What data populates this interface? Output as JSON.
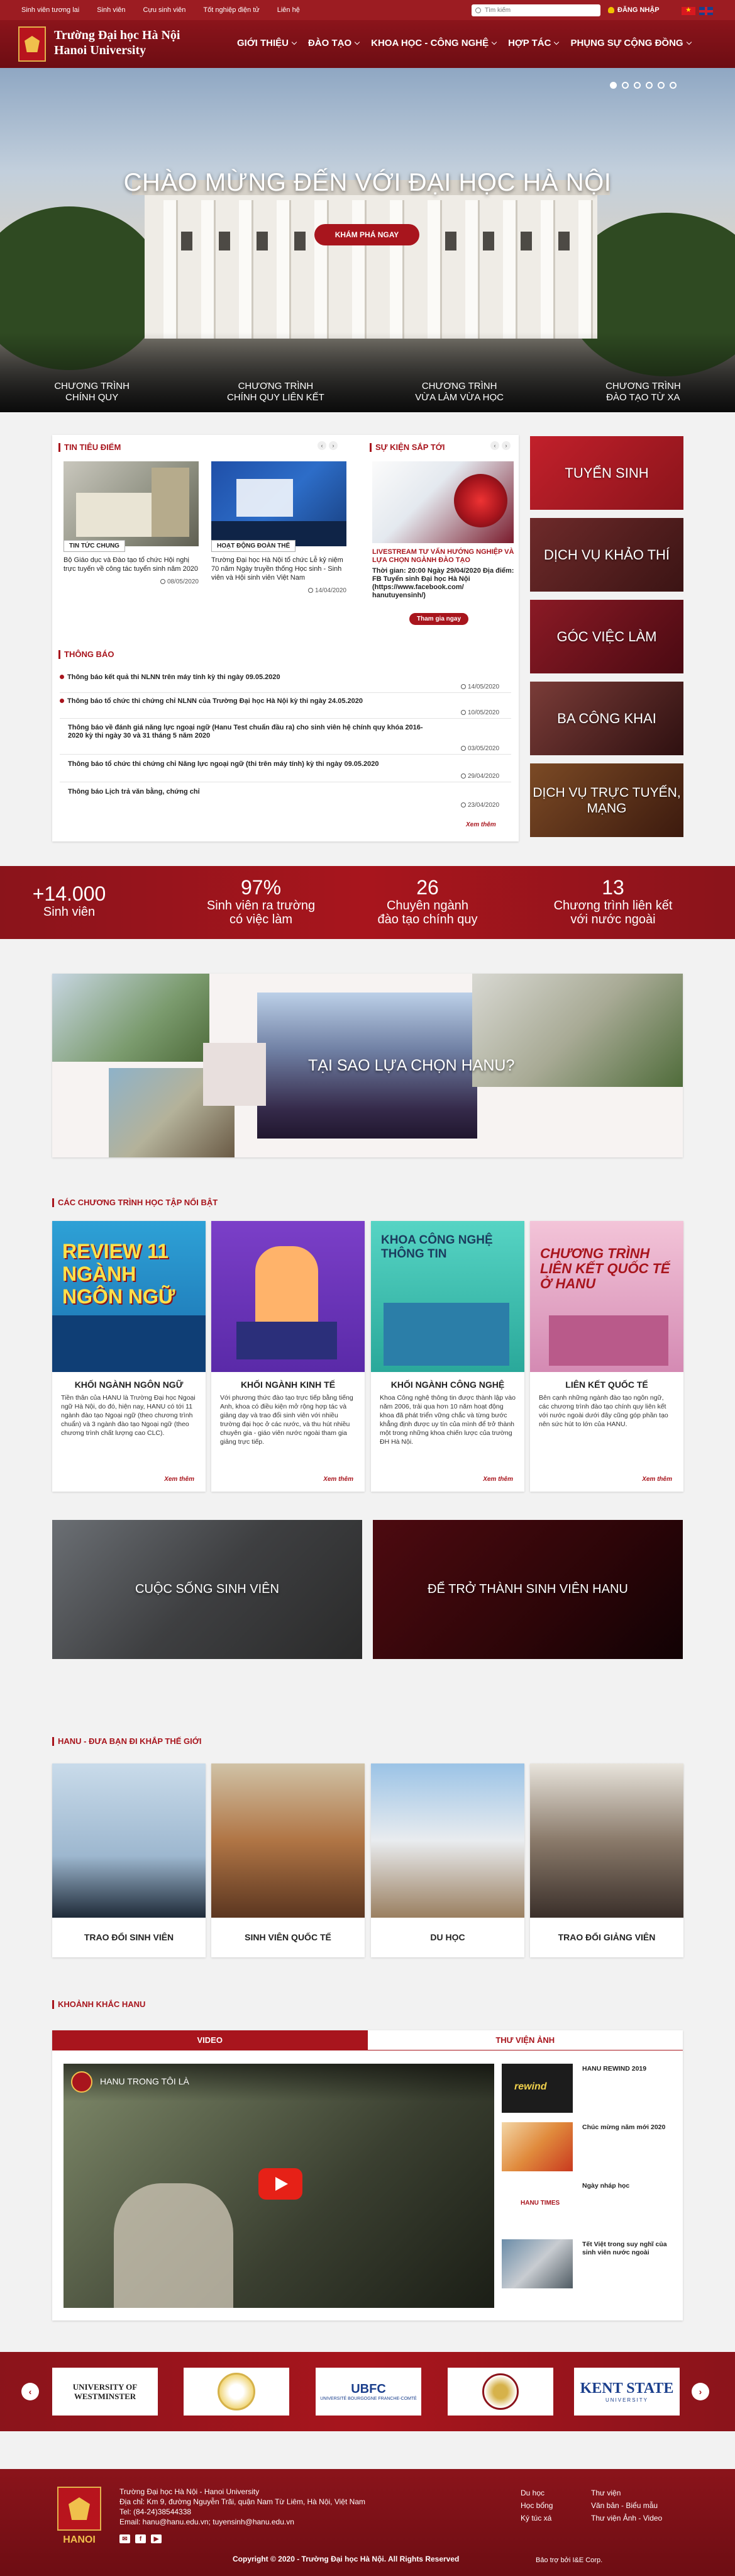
{
  "topbar": {
    "links": [
      "Sinh viên tương lai",
      "Sinh viên",
      "Cựu sinh viên",
      "Tốt nghiệp điện tử",
      "Liên hệ"
    ],
    "search_placeholder": "Tìm kiếm",
    "login": "ĐĂNG NHẬP"
  },
  "header": {
    "name_vn": "Trường Đại học Hà Nội",
    "name_en": "Hanoi University",
    "logo_caption": "HANOI",
    "nav": [
      "GIỚI THIỆU",
      "ĐÀO TẠO",
      "KHOA HỌC - CÔNG NGHỆ",
      "HỢP TÁC",
      "PHỤNG SỰ CỘNG ĐỒNG"
    ]
  },
  "hero": {
    "title": "CHÀO MỪNG ĐẾN VỚI ĐẠI HỌC HÀ NỘI",
    "button": "KHÁM PHÁ NGAY",
    "programs": [
      {
        "l1": "CHƯƠNG TRÌNH",
        "l2": "CHÍNH QUY"
      },
      {
        "l1": "CHƯƠNG TRÌNH",
        "l2": "CHÍNH QUY LIÊN KẾT"
      },
      {
        "l1": "CHƯƠNG TRÌNH",
        "l2": "VỪA LÀM VỪA HỌC"
      },
      {
        "l1": "CHƯƠNG TRÌNH",
        "l2": "ĐÀO TẠO TỪ XA"
      }
    ]
  },
  "news": {
    "heading": "TIN TIÊU ĐIỂM",
    "items": [
      {
        "tag": "TIN TỨC CHUNG",
        "title": "Bộ Giáo dục và Đào tạo tổ chức Hội nghị trực tuyến về công tác tuyển sinh năm 2020",
        "date": "08/05/2020"
      },
      {
        "tag": "HOẠT ĐỘNG ĐOÀN THỂ",
        "title": "Trường Đại học Hà Nội tổ chức Lễ kỷ niệm 70 năm Ngày truyền thống Học sinh - Sinh viên và Hội sinh viên Việt Nam",
        "date": "14/04/2020"
      }
    ]
  },
  "events": {
    "heading": "SỰ KIỆN SẮP TỚI",
    "title": "LIVESTREAM TƯ VẤN HƯỚNG NGHIỆP VÀ LỰA CHỌN NGÀNH ĐÀO TẠO",
    "info": "Thời gian: 20:00 Ngày 29/04/2020 Địa điểm: FB Tuyển sinh Đại học Hà Nội (https://www.facebook.com/ hanutuyensinh/)",
    "button": "Tham gia ngay"
  },
  "announcements": {
    "heading": "THÔNG BÁO",
    "items": [
      {
        "text": "Thông báo kết quả thi NLNN trên máy tính kỳ thi ngày 09.05.2020",
        "date": "14/05/2020",
        "hot": true
      },
      {
        "text": "Thông báo tổ chức thi chứng chỉ NLNN của Trường Đại học Hà Nội kỳ thi ngày 24.05.2020",
        "date": "10/05/2020",
        "hot": true
      },
      {
        "text": "Thông báo về đánh giá năng lực ngoại ngữ (Hanu Test chuẩn đầu ra) cho sinh viên hệ chính quy khóa 2016-2020 kỳ thi ngày 30 và 31 tháng 5 năm 2020",
        "date": "03/05/2020",
        "hot": false
      },
      {
        "text": "Thông báo tổ chức thi chứng chỉ Năng lực ngoại ngữ (thi trên máy tính) kỳ thi ngày 09.05.2020",
        "date": "29/04/2020",
        "hot": false
      },
      {
        "text": "Thông báo Lịch trả văn bằng, chứng chỉ",
        "date": "23/04/2020",
        "hot": false
      }
    ],
    "more": "Xem thêm"
  },
  "side_tiles": [
    "TUYỂN SINH",
    "DỊCH VỤ KHẢO THÍ",
    "GÓC VIỆC LÀM",
    "BA CÔNG KHAI",
    "DỊCH VỤ TRỰC TUYẾN, MẠNG"
  ],
  "stats": [
    {
      "num": "+14.000",
      "l1": "Sinh viên",
      "l2": ""
    },
    {
      "num": "97%",
      "l1": "Sinh viên ra trường",
      "l2": "có việc làm"
    },
    {
      "num": "26",
      "l1": "Chuyên ngành",
      "l2": "đào tạo chính quy"
    },
    {
      "num": "13",
      "l1": "Chương trình liên kết",
      "l2": "với nước ngoài"
    }
  ],
  "why": {
    "label": "TẠI SAO LỰA CHỌN HANU?"
  },
  "programs": {
    "heading": "CÁC CHƯƠNG TRÌNH HỌC TẬP NỔI BẬT",
    "cards": [
      {
        "img_text": "REVIEW 11 NGÀNH NGÔN NGỮ",
        "title": "KHỐI NGÀNH NGÔN NGỮ",
        "desc": "Tiền thân của HANU là Trường Đại học Ngoại ngữ Hà Nội, do đó, hiện nay, HANU có tới 11 ngành đào tạo Ngoại ngữ (theo chương trình chuẩn) và 3 ngành đào tạo Ngoại ngữ (theo chương trình chất lượng cao CLC).",
        "more": "Xem thêm"
      },
      {
        "img_text": "",
        "title": "KHỐI NGÀNH KINH TẾ",
        "desc": "Với phương thức đào tạo trực tiếp bằng tiếng Anh, khoa có điều kiện mở rộng hợp tác và giảng dạy và trao đổi sinh viên với nhiều trường đại học ở các nước, và thu hút nhiều chuyên gia - giáo viên nước ngoài tham gia giảng trực tiếp.",
        "more": "Xem thêm"
      },
      {
        "img_text": "KHOA CÔNG NGHỆ THÔNG TIN",
        "title": "KHỐI NGÀNH CÔNG NGHỆ",
        "desc": "Khoa Công nghệ thông tin được thành lập vào năm 2006, trải qua hơn 10 năm hoạt động khoa đã phát triển vững chắc và từng bước khẳng định được uy tín của mình để trở thành một trong những khoa chiến lược của trường ĐH Hà Nội.",
        "more": "Xem thêm"
      },
      {
        "img_text": "CHƯƠNG TRÌNH LIÊN KẾT QUỐC TẾ Ở HANU",
        "title": "LIÊN KẾT QUỐC TẾ",
        "desc": "Bên cạnh những ngành đào tạo ngôn ngữ, các chương trình đào tạo chính quy liên kết với nước ngoài dưới đây cũng góp phần tạo nên sức hút to lớn của HANU.",
        "more": "Xem thêm"
      }
    ]
  },
  "life_tiles": [
    "CUỘC SỐNG SINH VIÊN",
    "ĐỂ TRỞ THÀNH SINH VIÊN HANU"
  ],
  "exchange": {
    "heading": "HANU - ĐƯA BẠN ĐI KHẮP THẾ GIỚI",
    "cards": [
      "TRAO ĐỔI SINH VIÊN",
      "SINH VIÊN QUỐC TẾ",
      "DU HỌC",
      "TRAO ĐỔI GIẢNG VIÊN"
    ]
  },
  "moments": {
    "heading": "KHOẢNH KHẮC HANU",
    "tabs": [
      "VIDEO",
      "THƯ VIỆN ẢNH"
    ],
    "video_title": "HANU TRONG TÔI LÀ",
    "playlist": [
      {
        "title": "HANU REWIND 2019",
        "thumb_text": "rewind"
      },
      {
        "title": "Chúc mừng năm mới 2020",
        "thumb_text": ""
      },
      {
        "title": "Ngày nháp học",
        "thumb_text": "HANU TIMES"
      },
      {
        "title": "Tết Việt trong suy nghĩ của sinh viên nước ngoài",
        "thumb_text": ""
      }
    ]
  },
  "partners": [
    {
      "name": "UNIVERSITY OF WESTMINSTER",
      "sub": ""
    },
    {
      "name": "",
      "sub": ""
    },
    {
      "name": "UBFC",
      "sub": "UNIVERSITÉ BOURGOGNE FRANCHE-COMTÉ"
    },
    {
      "name": "",
      "sub": ""
    },
    {
      "name": "KENT STATE",
      "sub": "UNIVERSITY"
    }
  ],
  "footer": {
    "lines": [
      "Trường Đại học Hà Nội - Hanoi University",
      "Địa chỉ: Km 9, đường Nguyễn Trãi, quận Nam Từ Liêm, Hà Nội, Việt Nam",
      "Tel: (84-24)38544338",
      "Email: hanu@hanu.edu.vn; tuyensinh@hanu.edu.vn"
    ],
    "col1": [
      "Du học",
      "Học bổng",
      "Ký túc xá"
    ],
    "col2": [
      "Thư viện",
      "Văn bản - Biểu mẫu",
      "Thư viện Ảnh - Video"
    ],
    "copyright": "Copyright © 2020 - Trường Đại học Hà Nội. All Rights Reserved",
    "sponsor": "Bảo trợ bởi I&E Corp."
  },
  "colors": {
    "brand": "#a8151d",
    "brand_dark": "#6d0d13",
    "accent": "#f2c200"
  }
}
